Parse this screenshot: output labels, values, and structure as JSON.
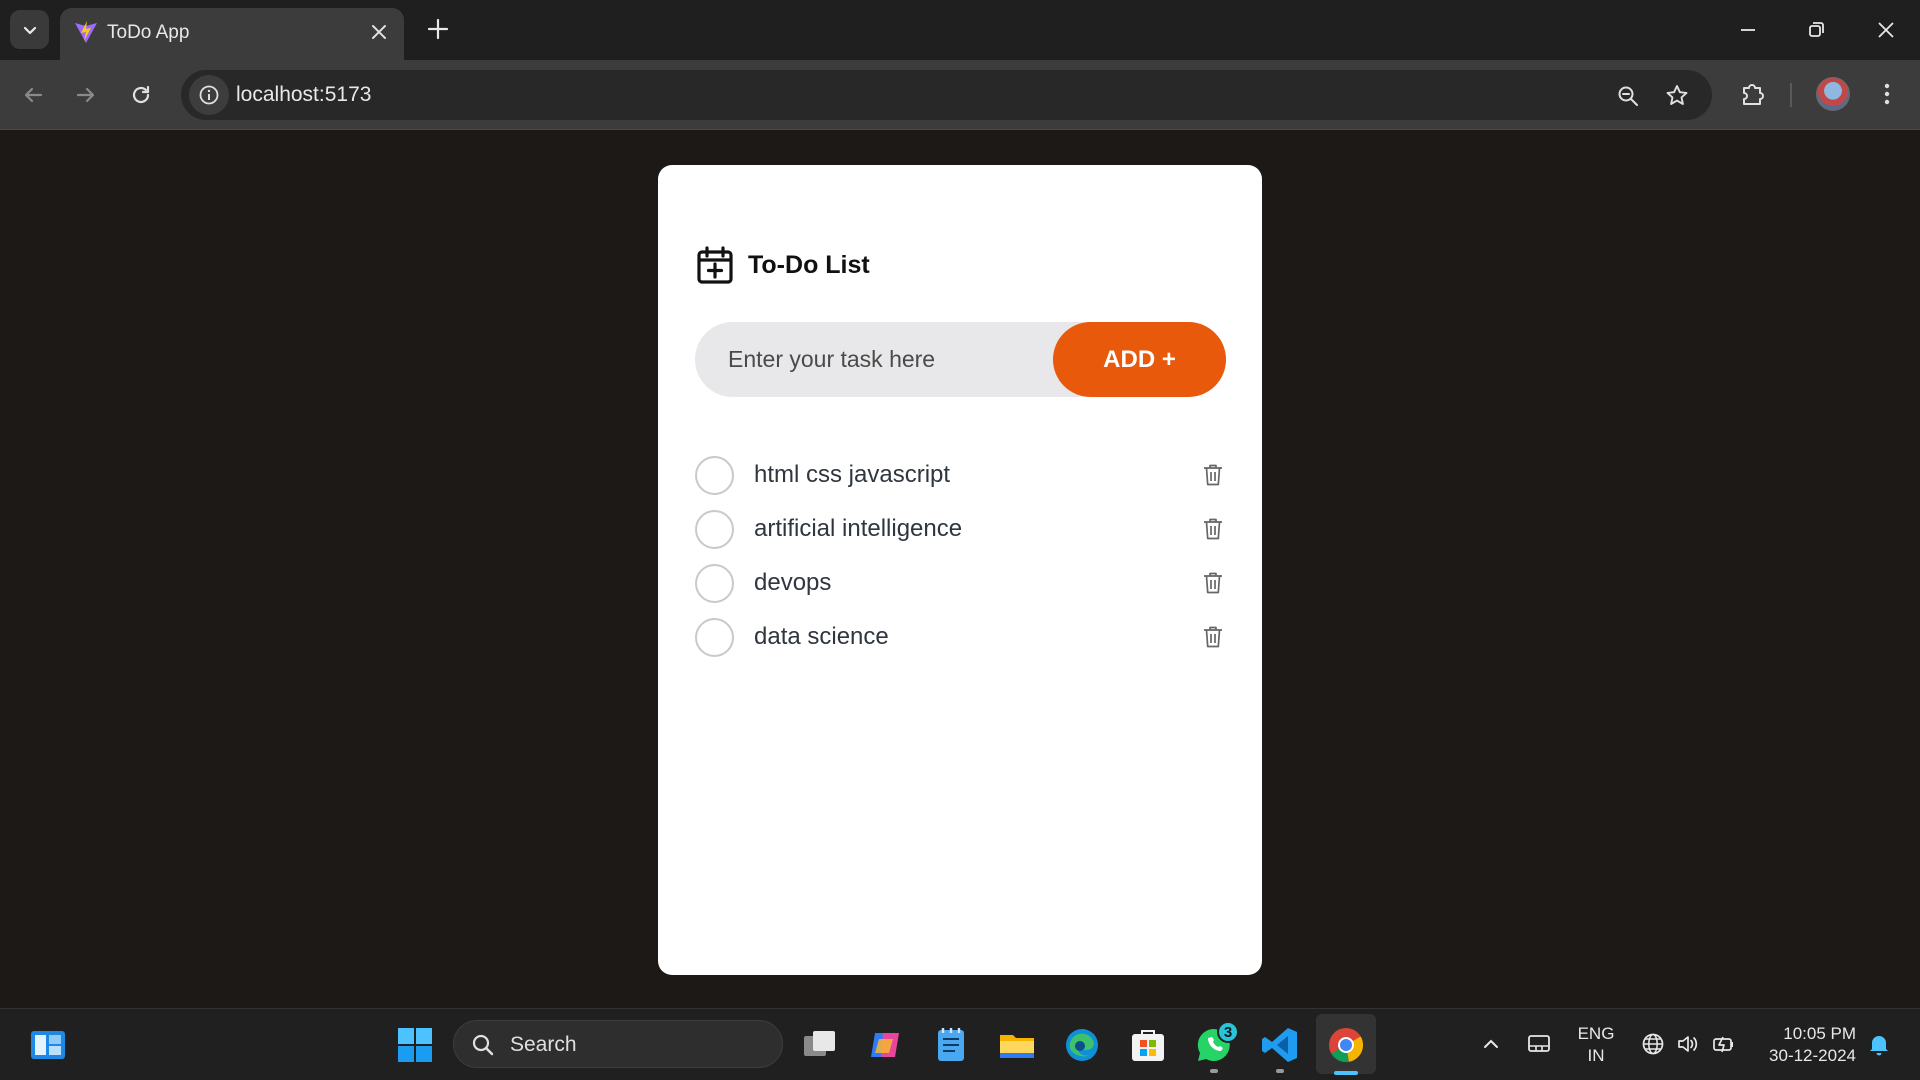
{
  "browser": {
    "tab_title": "ToDo App",
    "url": "localhost:5173"
  },
  "app": {
    "title": "To-Do List",
    "input_placeholder": "Enter your task here",
    "input_value": "",
    "add_button_label": "ADD +",
    "accent_color": "#e8590c",
    "tasks": [
      {
        "label": "html css javascript",
        "completed": false
      },
      {
        "label": "artificial intelligence",
        "completed": false
      },
      {
        "label": "devops",
        "completed": false
      },
      {
        "label": "data science",
        "completed": false
      }
    ]
  },
  "taskbar": {
    "search_label": "Search",
    "whatsapp_badge": "3",
    "language_line1": "ENG",
    "language_line2": "IN",
    "time": "10:05 PM",
    "date": "30-12-2024",
    "pinned_icons": [
      "task-view-icon",
      "copilot-icon",
      "notepad-icon",
      "file-explorer-icon",
      "edge-icon",
      "microsoft-store-icon",
      "whatsapp-icon",
      "vscode-icon",
      "chrome-icon"
    ]
  }
}
